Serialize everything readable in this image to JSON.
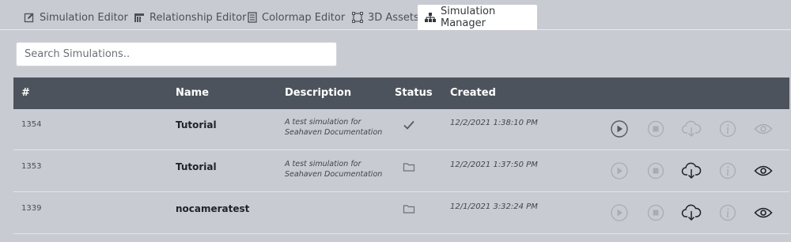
{
  "tabs": [
    {
      "label": "Simulation Editor",
      "icon": "edit-icon"
    },
    {
      "label": "Relationship Editor",
      "icon": "relationship-icon"
    },
    {
      "label": "Colormap Editor",
      "icon": "colormap-icon"
    },
    {
      "label": "3D Assets",
      "icon": "3d-asset-icon"
    },
    {
      "label": "Simulation Manager",
      "icon": "sitemap-icon",
      "active": true
    }
  ],
  "search": {
    "placeholder": "Search Simulations.."
  },
  "table": {
    "headers": {
      "id": "#",
      "name": "Name",
      "description": "Description",
      "status": "Status",
      "created": "Created"
    },
    "rows": [
      {
        "id": "1354",
        "name": "Tutorial",
        "description_line1": "A test simulation for",
        "description_line2": "Seahaven Documentation",
        "status": "check-icon",
        "created": "12/2/2021 1:38:10 PM",
        "actions": {
          "play": true,
          "stop": false,
          "download": false,
          "info": false,
          "view": false
        }
      },
      {
        "id": "1353",
        "name": "Tutorial",
        "description_line1": "A test simulation for",
        "description_line2": "Seahaven Documentation",
        "status": "folder-icon",
        "created": "12/2/2021 1:37:50 PM",
        "actions": {
          "play": false,
          "stop": false,
          "download": true,
          "info": false,
          "view": true
        }
      },
      {
        "id": "1339",
        "name": "nocameratest",
        "description_line1": "",
        "description_line2": "",
        "status": "folder-icon",
        "created": "12/1/2021 3:32:24 PM",
        "actions": {
          "play": false,
          "stop": false,
          "download": true,
          "info": false,
          "view": true
        }
      }
    ]
  },
  "colors": {
    "background": "#c9cbd2",
    "header": "#4c535c",
    "icon_enabled": "#1e2126",
    "icon_enabled_soft": "#555a61",
    "icon_disabled": "#a9acb3"
  }
}
